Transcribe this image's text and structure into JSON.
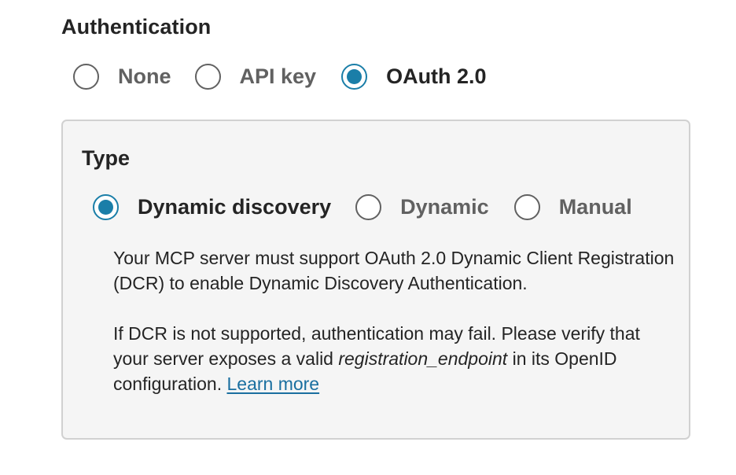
{
  "authentication": {
    "title": "Authentication",
    "options": [
      {
        "label": "None",
        "selected": false
      },
      {
        "label": "API key",
        "selected": false
      },
      {
        "label": "OAuth 2.0",
        "selected": true
      }
    ]
  },
  "oauth_panel": {
    "type_title": "Type",
    "type_options": [
      {
        "label": "Dynamic discovery",
        "selected": true
      },
      {
        "label": "Dynamic",
        "selected": false
      },
      {
        "label": "Manual",
        "selected": false
      }
    ],
    "description_1": "Your MCP server must support OAuth 2.0 Dynamic Client Registration (DCR) to enable Dynamic Discovery Authentication.",
    "description_2_prefix": "If DCR is not supported, authentication may fail. Please verify that your server exposes a valid ",
    "description_2_code": "registration_endpoint",
    "description_2_suffix": " in its OpenID configuration. ",
    "learn_more_label": "Learn more"
  },
  "colors": {
    "accent": "#1a7ea8",
    "panel_background": "#f5f5f5",
    "panel_border": "#d1d1d1",
    "text_primary": "#242424",
    "text_secondary": "#616161",
    "link": "#1a6fa0"
  }
}
